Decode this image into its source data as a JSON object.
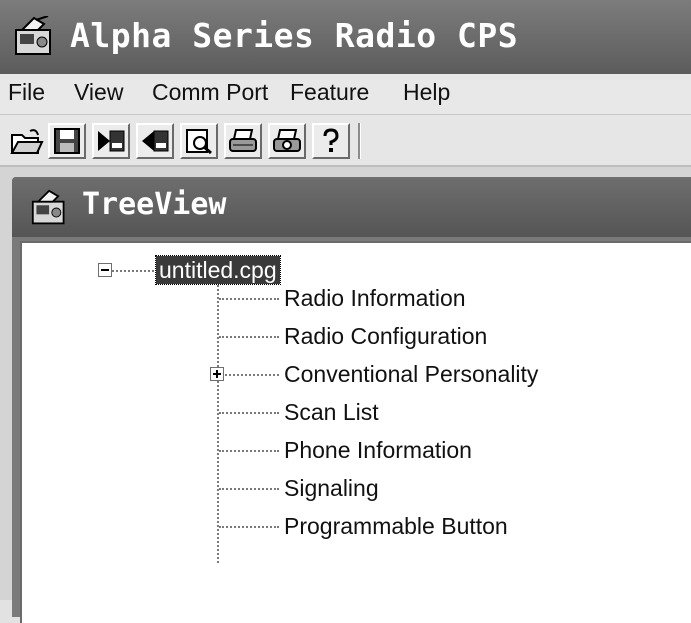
{
  "window": {
    "title": "Alpha Series Radio CPS",
    "icon": "radio-app-icon"
  },
  "menu": [
    {
      "label": "File"
    },
    {
      "label": "View"
    },
    {
      "label": "Comm Port"
    },
    {
      "label": "Feature"
    },
    {
      "label": "Help"
    }
  ],
  "toolbar": {
    "buttons": [
      {
        "icon": "open-folder-icon"
      },
      {
        "icon": "save-disk-icon"
      },
      {
        "icon": "read-radio-icon"
      },
      {
        "icon": "write-radio-icon"
      },
      {
        "icon": "print-preview-icon"
      },
      {
        "icon": "print-icon"
      },
      {
        "icon": "print-setup-icon"
      },
      {
        "icon": "help-icon"
      }
    ]
  },
  "treeview": {
    "title": "TreeView",
    "root": {
      "label": "untitled.cpg",
      "expanded": true,
      "selected": true
    },
    "children": [
      {
        "label": "Radio Information",
        "expandable": false
      },
      {
        "label": "Radio Configuration",
        "expandable": false
      },
      {
        "label": "Conventional Personality",
        "expandable": true,
        "expanded": false
      },
      {
        "label": "Scan List",
        "expandable": false
      },
      {
        "label": "Phone Information",
        "expandable": false
      },
      {
        "label": "Signaling",
        "expandable": false
      },
      {
        "label": "Programmable Button",
        "expandable": false
      }
    ]
  }
}
